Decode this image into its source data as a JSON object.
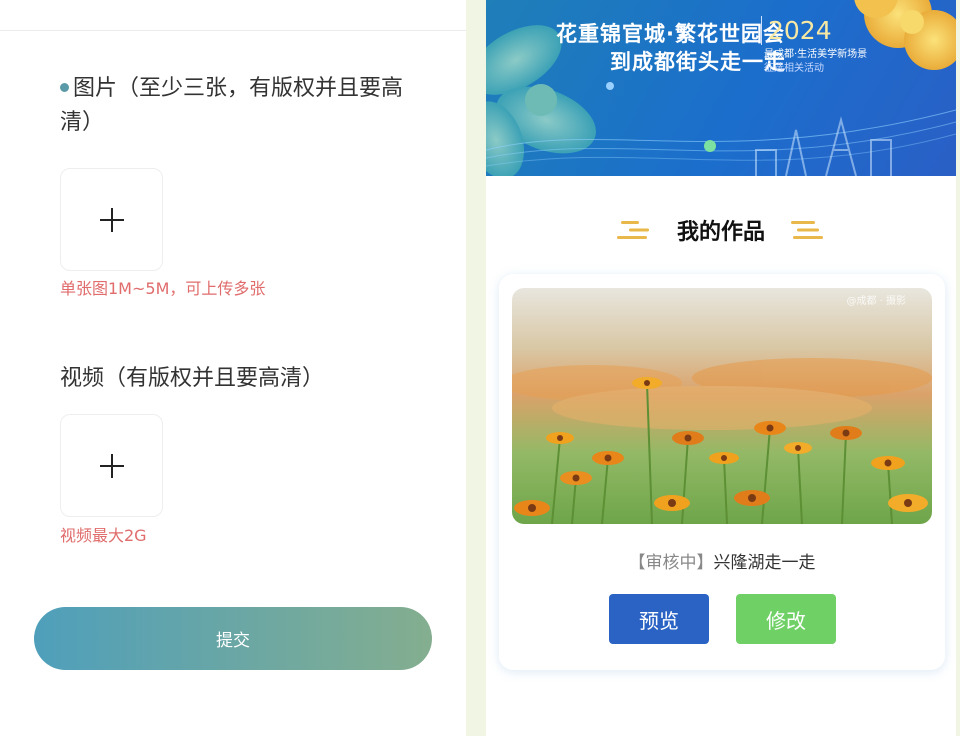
{
  "upload_form": {
    "image_field_label": "图片（至少三张，有版权并且要高清）",
    "image_hint": "单张图1M~5M，可上传多张",
    "video_field_label": "视频（有版权并且要高清）",
    "video_hint": "视频最大2G",
    "submit_label": "提交",
    "hint_color": "#e06c6c",
    "submit_gradient": [
      "#4f9fbb",
      "#84ae8f"
    ]
  },
  "icons": {
    "upload": "plus-icon",
    "section_decoration": "three-lines-icon",
    "bullet": "dot-icon"
  },
  "banner": {
    "line1": "花重锦官城·繁花世园会",
    "line2": "到成都街头走一走",
    "year": "2024",
    "subtitle": "最成都·生活美学新场景",
    "subtitle2": "征选相关活动"
  },
  "my_works": {
    "title": "我的作品",
    "items": [
      {
        "status": "【审核中】",
        "name": "兴隆湖走一走",
        "watermark": "@成都 · 摄影",
        "preview_label": "预览",
        "edit_label": "修改"
      }
    ]
  },
  "colors": {
    "preview_button": "#2a63c4",
    "edit_button": "#6fd066",
    "section_icon": "#e8b84a"
  }
}
